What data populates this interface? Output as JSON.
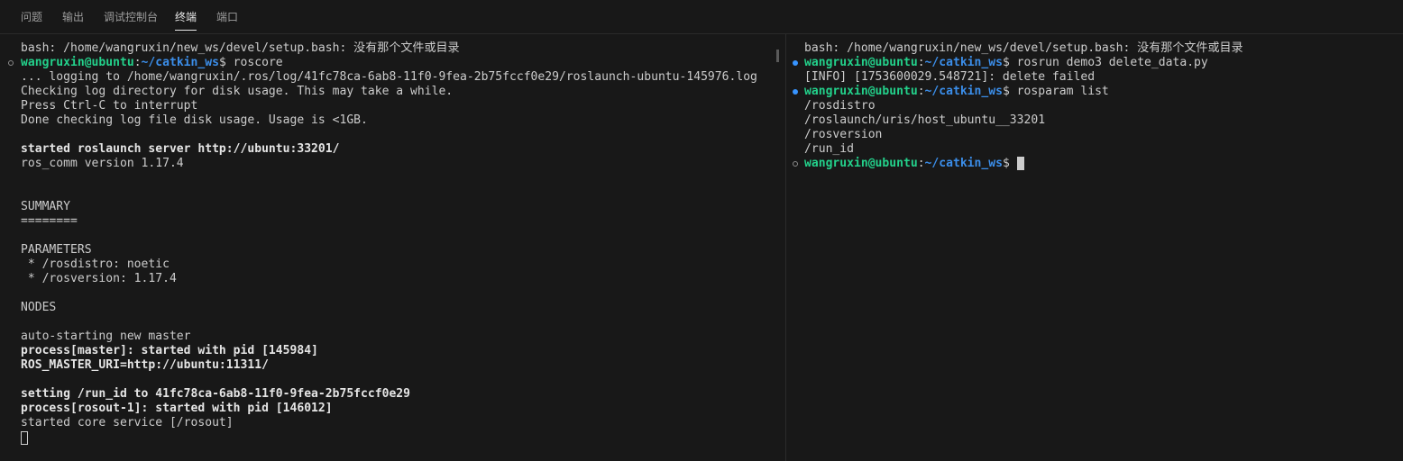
{
  "tabs": [
    {
      "label": "问题"
    },
    {
      "label": "输出"
    },
    {
      "label": "调试控制台"
    },
    {
      "label": "终端",
      "active": true
    },
    {
      "label": "端口"
    }
  ],
  "prompt": {
    "user_host": "wangruxin@ubuntu",
    "sep": ":",
    "path": "~/catkin_ws",
    "dollar": "$ "
  },
  "left_terminal": {
    "l01": "bash: /home/wangruxin/new_ws/devel/setup.bash: 没有那个文件或目录",
    "l02_cmd": "roscore",
    "l03": "... logging to /home/wangruxin/.ros/log/41fc78ca-6ab8-11f0-9fea-2b75fccf0e29/roslaunch-ubuntu-145976.log",
    "l04": "Checking log directory for disk usage. This may take a while.",
    "l05": "Press Ctrl-C to interrupt",
    "l06": "Done checking log file disk usage. Usage is <1GB.",
    "l08": "started roslaunch server http://ubuntu:33201/",
    "l09": "ros_comm version 1.17.4",
    "l12": "SUMMARY",
    "l13": "========",
    "l15": "PARAMETERS",
    "l16": " * /rosdistro: noetic",
    "l17": " * /rosversion: 1.17.4",
    "l19": "NODES",
    "l21": "auto-starting new master",
    "l22": "process[master]: started with pid [145984]",
    "l23": "ROS_MASTER_URI=http://ubuntu:11311/",
    "l25": "setting /run_id to 41fc78ca-6ab8-11f0-9fea-2b75fccf0e29",
    "l26": "process[rosout-1]: started with pid [146012]",
    "l27": "started core service [/rosout]"
  },
  "right_terminal": {
    "r01": "bash: /home/wangruxin/new_ws/devel/setup.bash: 没有那个文件或目录",
    "r02_cmd": "rosrun demo3 delete_data.py",
    "r03": "[INFO] [1753600029.548721]: delete failed",
    "r04_cmd": "rosparam list",
    "r05": "/rosdistro",
    "r06": "/roslaunch/uris/host_ubuntu__33201",
    "r07": "/rosversion",
    "r08": "/run_id"
  },
  "colors": {
    "background": "#181818",
    "prompt_user": "#23d18b",
    "prompt_path": "#3b8eea",
    "decoration_success": "#3794ff"
  }
}
